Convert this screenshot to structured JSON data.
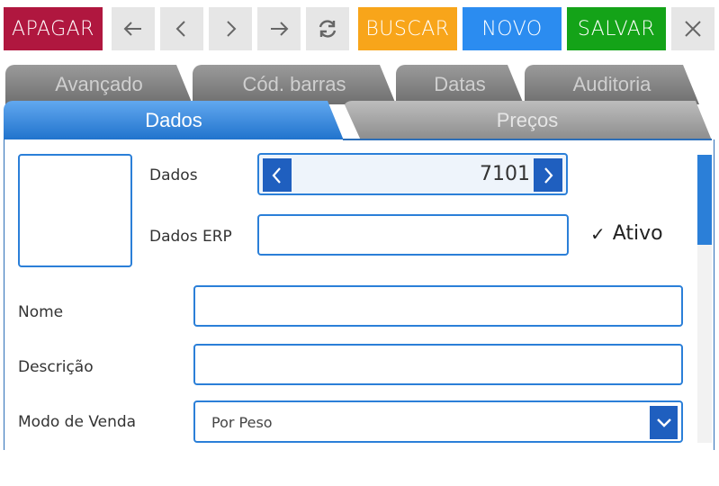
{
  "toolbar": {
    "apagar": "APAGAR",
    "buscar": "BUSCAR",
    "novo": "NOVO",
    "salvar": "SALVAR",
    "icons": [
      "arrow-left-icon",
      "chevron-left-icon",
      "chevron-right-icon",
      "arrow-right-icon",
      "refresh-icon",
      "close-icon"
    ]
  },
  "tabs": {
    "row_back": [
      "Avançado",
      "Cód. barras",
      "Datas",
      "Auditoria"
    ],
    "row_front": [
      "Dados",
      "Preços"
    ],
    "active": "Dados"
  },
  "form": {
    "dados_label": "Dados",
    "dados_value": "7101",
    "dados_erp_label": "Dados ERP",
    "dados_erp_value": "",
    "ativo_label": "Ativo",
    "ativo_checked": true,
    "nome_label": "Nome",
    "nome_value": "",
    "descricao_label": "Descrição",
    "descricao_value": "",
    "modo_venda_label": "Modo de Venda",
    "modo_venda_value": "Por Peso"
  },
  "colors": {
    "apagar": "#b0173f",
    "buscar": "#f8a51a",
    "novo": "#2b8cf0",
    "salvar": "#14a318",
    "accent": "#2b7fd8"
  }
}
